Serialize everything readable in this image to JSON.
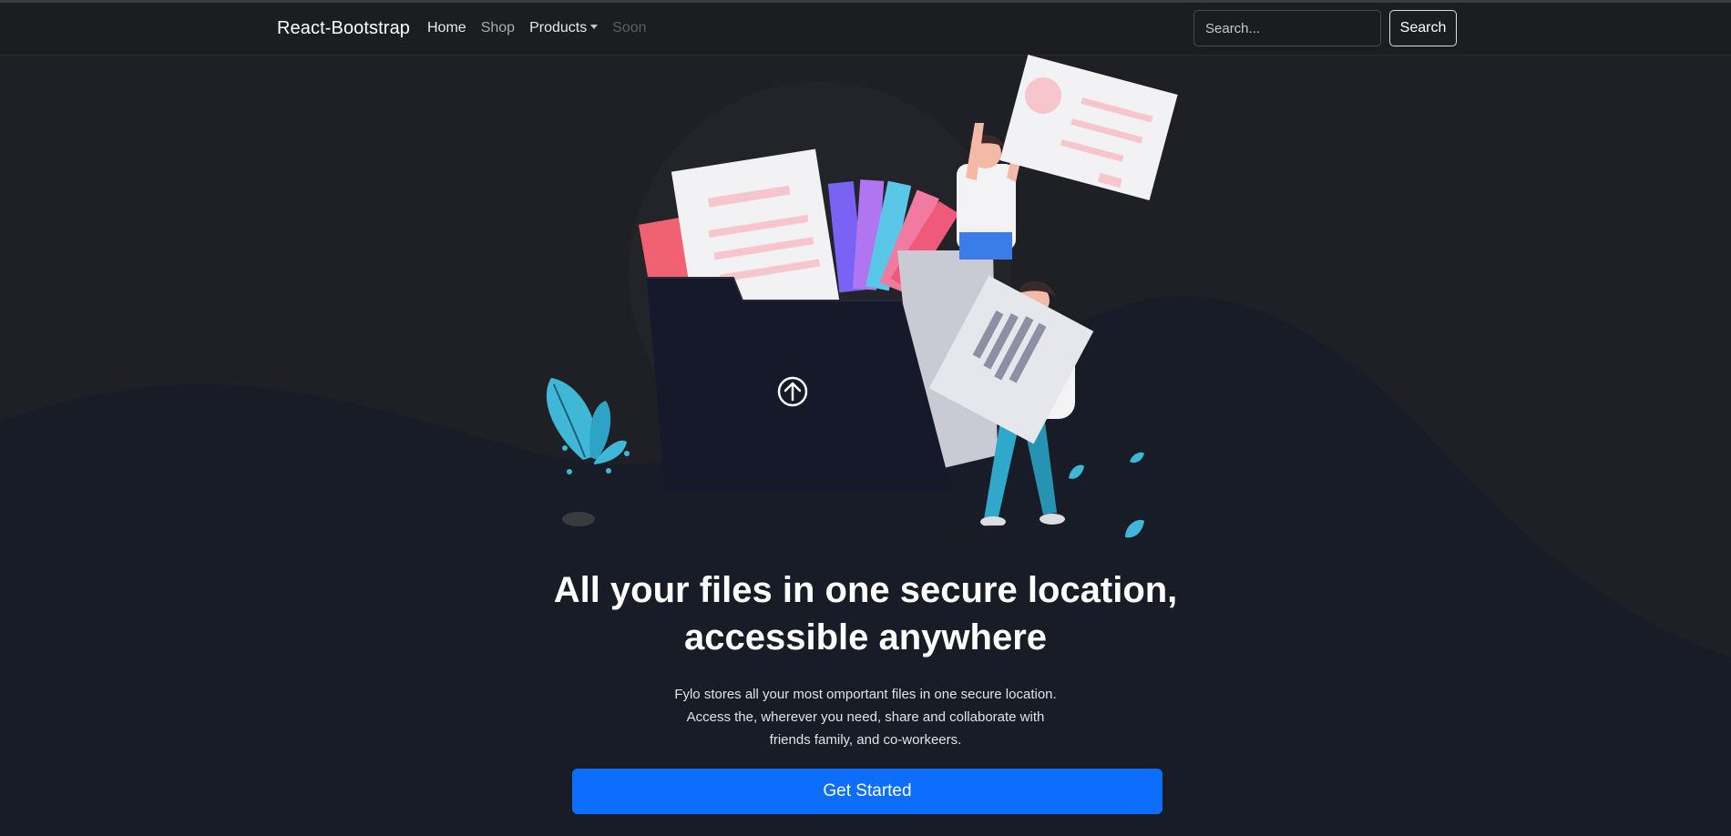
{
  "navbar": {
    "brand": "React-Bootstrap",
    "links": [
      {
        "label": "Home"
      },
      {
        "label": "Shop"
      },
      {
        "label": "Products"
      },
      {
        "label": "Soon"
      }
    ],
    "search": {
      "placeholder": "Search...",
      "value": "",
      "button_label": "Search"
    }
  },
  "hero": {
    "headline_line1": "All your files in one secure location,",
    "headline_line2": "accessible anywhere",
    "sub_line1": "Fylo stores all your most omportant files in one secure location.",
    "sub_line2": "Access the, wherever you need, share and collaborate with",
    "sub_line3": "friends family, and co-workeers.",
    "cta_label": "Get Started"
  },
  "colors": {
    "background": "#1f2025",
    "navbar": "#1c1d21",
    "wave": "#181c27",
    "primary_button": "#0d6efd",
    "accent_teal": "#3fb8d8"
  },
  "icons": [
    "caret-down-icon",
    "upload-arrow-icon",
    "leaf-icon"
  ]
}
